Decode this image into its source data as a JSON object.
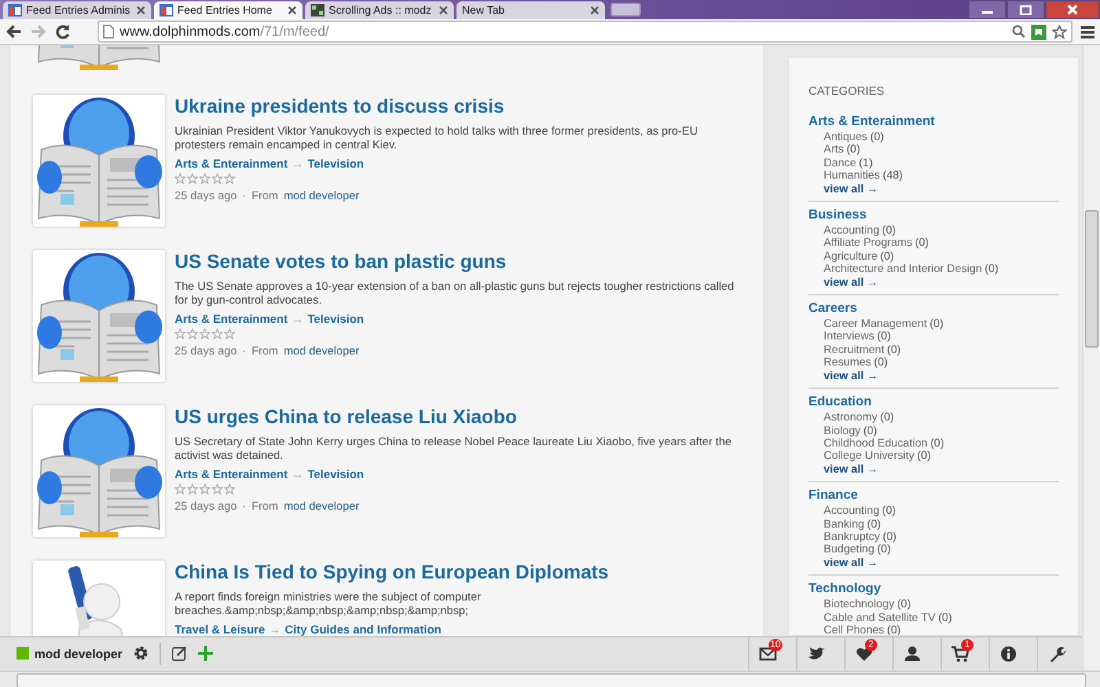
{
  "browser": {
    "tabs": [
      {
        "title": "Feed Entries Adminis",
        "kind": "site",
        "selected": false
      },
      {
        "title": "Feed Entries Home",
        "kind": "site",
        "selected": true
      },
      {
        "title": "Scrolling Ads :: modz",
        "kind": "grid",
        "selected": false
      },
      {
        "title": "New Tab",
        "kind": "blank",
        "selected": false
      }
    ],
    "url_host": "www.dolphinmods.com",
    "url_path": "/71/m/feed/"
  },
  "articles": [
    {
      "kind": "newspaper",
      "title": "Ukraine presidents to discuss crisis",
      "summary": "Ukrainian President Viktor Yanukovych is expected to hold talks with three former presidents, as pro-EU protesters remain encamped in central Kiev.",
      "category": "Arts & Enterainment",
      "arrow": "→",
      "subcategory": "Television",
      "stars": 0,
      "age": "25 days ago",
      "separator": "·",
      "from_label": "From",
      "author": "mod developer"
    },
    {
      "kind": "newspaper",
      "title": "US Senate votes to ban plastic guns",
      "summary": "The US Senate approves a 10-year extension of a ban on all-plastic guns but rejects tougher restrictions called for by gun-control advocates.",
      "category": "Arts & Enterainment",
      "arrow": "→",
      "subcategory": "Television",
      "stars": 0,
      "age": "25 days ago",
      "separator": "·",
      "from_label": "From",
      "author": "mod developer"
    },
    {
      "kind": "newspaper",
      "title": "US urges China to release Liu Xiaobo",
      "summary": "US Secretary of State John Kerry urges China to release Nobel Peace laureate Liu Xiaobo, five years after the activist was detained.",
      "category": "Arts & Enterainment",
      "arrow": "→",
      "subcategory": "Television",
      "stars": 0,
      "age": "25 days ago",
      "separator": "·",
      "from_label": "From",
      "author": "mod developer"
    },
    {
      "kind": "figure",
      "title": "China Is Tied to Spying on European Diplomats",
      "summary": "A report finds foreign ministries were the subject of computer breaches.&amp;nbsp;&amp;nbsp;&amp;nbsp;&amp;nbsp;",
      "category": "Travel & Leisure",
      "arrow": "→",
      "subcategory": "City Guides and Information"
    }
  ],
  "sidebar": {
    "title": "CATEGORIES",
    "groups": [
      {
        "name": "Arts & Enterainment",
        "items": [
          {
            "label": "Antiques",
            "count": "(0)"
          },
          {
            "label": "Arts",
            "count": "(0)"
          },
          {
            "label": "Dance",
            "count": "(1)"
          },
          {
            "label": "Humanities",
            "count": "(48)"
          }
        ],
        "view_all": "view all →"
      },
      {
        "name": "Business",
        "items": [
          {
            "label": "Accounting",
            "count": "(0)"
          },
          {
            "label": "Affiliate Programs",
            "count": "(0)"
          },
          {
            "label": "Agriculture",
            "count": "(0)"
          },
          {
            "label": "Architecture and Interior Design",
            "count": "(0)"
          }
        ],
        "view_all": "view all →"
      },
      {
        "name": "Careers",
        "items": [
          {
            "label": "Career Management",
            "count": "(0)"
          },
          {
            "label": "Interviews",
            "count": "(0)"
          },
          {
            "label": "Recruitment",
            "count": "(0)"
          },
          {
            "label": "Resumes",
            "count": "(0)"
          }
        ],
        "view_all": "view all →"
      },
      {
        "name": "Education",
        "items": [
          {
            "label": "Astronomy",
            "count": "(0)"
          },
          {
            "label": "Biology",
            "count": "(0)"
          },
          {
            "label": "Childhood Education",
            "count": "(0)"
          },
          {
            "label": "College University",
            "count": "(0)"
          }
        ],
        "view_all": "view all →"
      },
      {
        "name": "Finance",
        "items": [
          {
            "label": "Accounting",
            "count": "(0)"
          },
          {
            "label": "Banking",
            "count": "(0)"
          },
          {
            "label": "Bankruptcy",
            "count": "(0)"
          },
          {
            "label": "Budgeting",
            "count": "(0)"
          }
        ],
        "view_all": "view all →"
      },
      {
        "name": "Technology",
        "items": [
          {
            "label": "Biotechnology",
            "count": "(0)"
          },
          {
            "label": "Cable and Satellite TV",
            "count": "(0)"
          },
          {
            "label": "Cell Phones",
            "count": "(0)"
          }
        ]
      }
    ]
  },
  "admin_bar": {
    "user": "mod developer",
    "color": "#5fb800",
    "tools": [
      {
        "kind": "mail",
        "badge": "10"
      },
      {
        "kind": "bird"
      },
      {
        "kind": "heart",
        "badge": "2"
      },
      {
        "kind": "user"
      },
      {
        "kind": "cart",
        "badge": "1"
      },
      {
        "kind": "info"
      },
      {
        "kind": "wrench"
      }
    ]
  }
}
